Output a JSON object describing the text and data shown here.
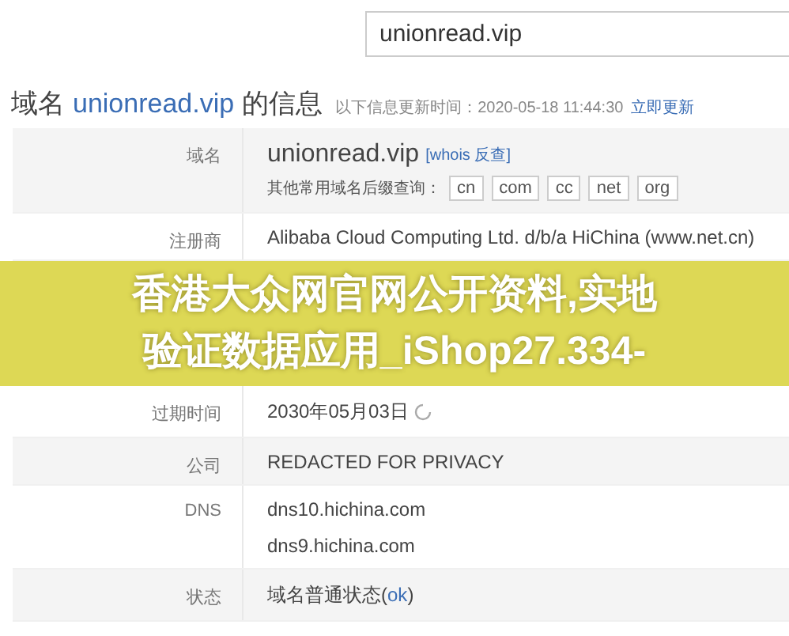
{
  "search": {
    "value": "unionread.vip"
  },
  "heading": {
    "prefix": "域名",
    "domain": "unionread.vip",
    "suffix": "的信息",
    "update_note": "以下信息更新时间：2020-05-18 11:44:30",
    "refresh_link": "立即更新"
  },
  "rows": [
    {
      "kind": "domain",
      "label": "域名",
      "value": "unionread.vip",
      "link": "[whois 反查]",
      "suffix_label": "其他常用域名后缀查询：",
      "suffixes": [
        "cn",
        "com",
        "cc",
        "net",
        "org"
      ]
    },
    {
      "kind": "text",
      "label": "注册商",
      "value": "Alibaba Cloud Computing Ltd. d/b/a HiChina (www.net.cn)"
    },
    {
      "kind": "banner",
      "lines": [
        "香港大众网官网公开资料,实地",
        "验证数据应用_iShop27.334-"
      ]
    },
    {
      "kind": "refresh",
      "label": "过期时间",
      "value": "2030年05月03日"
    },
    {
      "kind": "text",
      "label": "公司",
      "value": "REDACTED FOR PRIVACY"
    },
    {
      "kind": "lines",
      "label": "DNS",
      "values": [
        "dns10.hichina.com",
        "dns9.hichina.com"
      ]
    },
    {
      "kind": "status",
      "label": "状态",
      "value": "域名普通状态(",
      "link": "ok",
      "after": ")"
    }
  ]
}
